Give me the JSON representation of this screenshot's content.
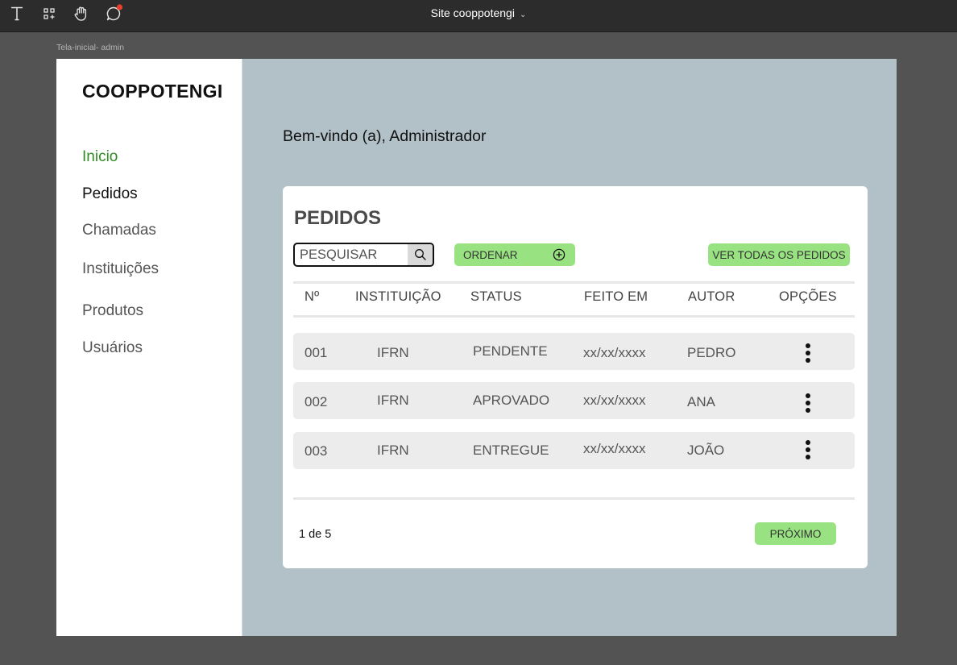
{
  "toolbar": {
    "file_title": "Site cooppotengi",
    "tools": [
      "text-tool-icon",
      "component-tool-icon",
      "hand-tool-icon",
      "comment-tool-icon"
    ],
    "comment_badge_color": "#e8402b"
  },
  "frame": {
    "label": "Tela-inicial- admin"
  },
  "sidebar": {
    "logo": "COOPPOTENGI",
    "items": [
      {
        "label": "Inicio",
        "active": true
      },
      {
        "label": "Pedidos"
      },
      {
        "label": "Chamadas"
      },
      {
        "label": "Instituições"
      },
      {
        "label": "Produtos"
      },
      {
        "label": "Usuários"
      }
    ]
  },
  "main": {
    "welcome": "Bem-vindo (a), Administrador",
    "card": {
      "title": "PEDIDOS",
      "search_placeholder": "PESQUISAR",
      "sort_label": "ORDENAR",
      "view_all_label": "VER TODAS OS PEDIDOS",
      "columns": [
        "Nº",
        "INSTITUIÇÃO",
        "STATUS",
        "FEITO EM",
        "AUTOR",
        "OPÇÕES"
      ],
      "rows": [
        {
          "num": "001",
          "institution": "IFRN",
          "status": "PENDENTE",
          "date": "xx/xx/xxxx",
          "author": "PEDRO"
        },
        {
          "num": "002",
          "institution": "IFRN",
          "status": "APROVADO",
          "date": "xx/xx/xxxx",
          "author": "ANA"
        },
        {
          "num": "003",
          "institution": "IFRN",
          "status": "ENTREGUE",
          "date": "xx/xx/xxxx",
          "author": "JOÃO"
        }
      ],
      "pagination": "1 de 5",
      "next_label": "PRÓXIMO"
    }
  },
  "colors": {
    "canvas": "#535353",
    "frame_bg": "#b2c0c8",
    "accent_green": "#99e282",
    "active_nav": "#2e8b22"
  }
}
